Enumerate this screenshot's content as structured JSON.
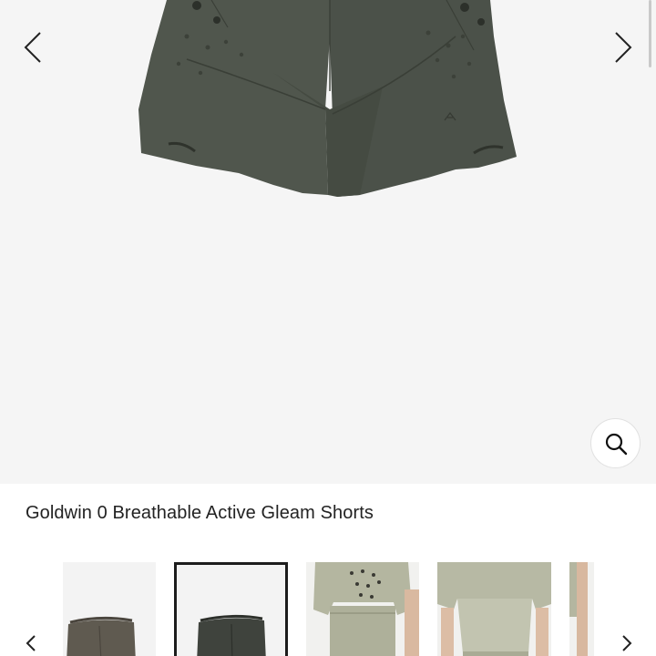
{
  "product": {
    "title": "Goldwin 0 Breathable Active Gleam Shorts"
  },
  "gallery": {
    "background": "#f5f5f5",
    "main_image": "shorts-front-photo",
    "prev_icon": "chevron-left-icon",
    "next_icon": "chevron-right-icon",
    "zoom_icon": "magnifier-icon"
  },
  "thumbnails": {
    "items": [
      {
        "image": "shorts-olive-thumbnail"
      },
      {
        "image": "shorts-charcoal-thumbnail",
        "selected": true
      },
      {
        "image": "model-front-thumbnail"
      },
      {
        "image": "model-torso-thumbnail"
      },
      {
        "image": "model-side-thumbnail"
      }
    ],
    "prev_icon": "chevron-left-icon",
    "next_icon": "chevron-right-icon"
  },
  "colors": {
    "shorts_main": "#4f554c",
    "shorts_shadow": "#3d423a",
    "selection_border": "#1c1c1c",
    "model_fabric": "#b7b9a3"
  }
}
